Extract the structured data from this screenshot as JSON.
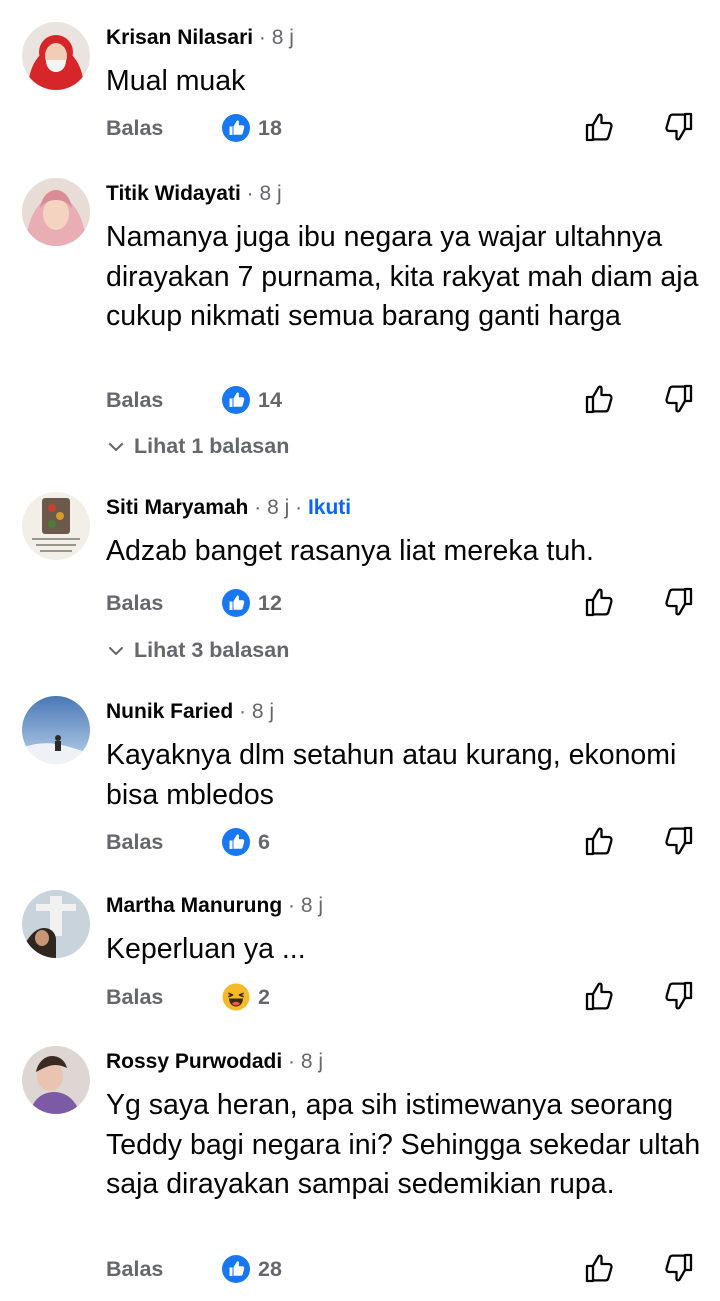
{
  "ui": {
    "reply_label": "Balas",
    "follow_label": "Ikuti",
    "separator": "·"
  },
  "comments": [
    {
      "name": "Krisan Nilasari",
      "time": "8 j",
      "text": "Mual muak",
      "reaction": {
        "type": "like",
        "count": "18"
      },
      "replies_label": null
    },
    {
      "name": "Titik Widayati",
      "time": "8 j",
      "text": "Namanya juga ibu negara ya wajar ultahnya dirayakan 7 purnama, kita rakyat mah diam aja cukup nikmati semua barang ganti harga",
      "reaction": {
        "type": "like",
        "count": "14"
      },
      "replies_label": "Lihat 1 balasan"
    },
    {
      "name": "Siti Maryamah",
      "time": "8 j",
      "text": "Adzab banget rasanya liat mereka tuh.",
      "reaction": {
        "type": "like",
        "count": "12"
      },
      "replies_label": "Lihat 3 balasan",
      "show_follow": true
    },
    {
      "name": "Nunik Faried",
      "time": "8 j",
      "text": "Kayaknya dlm setahun atau kurang, ekonomi bisa mbledos",
      "reaction": {
        "type": "like",
        "count": "6"
      },
      "replies_label": null
    },
    {
      "name": "Martha Manurung",
      "time": "8 j",
      "text": "Keperluan ya ...",
      "reaction": {
        "type": "haha",
        "count": "2"
      },
      "replies_label": null
    },
    {
      "name": "Rossy Purwodadi",
      "time": "8 j",
      "text": "Yg saya heran, apa sih istimewanya seorang Teddy bagi negara ini? Sehingga sekedar ultah saja dirayakan sampai sedemikian rupa.",
      "reaction": {
        "type": "like",
        "count": "28"
      },
      "replies_label": null
    }
  ],
  "colors": {
    "secondary_text": "#65676b",
    "like_blue": "#1877f2",
    "follow_blue": "#0866ff",
    "haha_yellow": "#f7b928"
  },
  "icons": {
    "like_reaction": "like-reaction-icon",
    "haha_reaction": "haha-reaction-icon",
    "upvote": "thumbs-up-outline-icon",
    "downvote": "thumbs-down-outline-icon",
    "expand": "chevron-down-icon"
  }
}
